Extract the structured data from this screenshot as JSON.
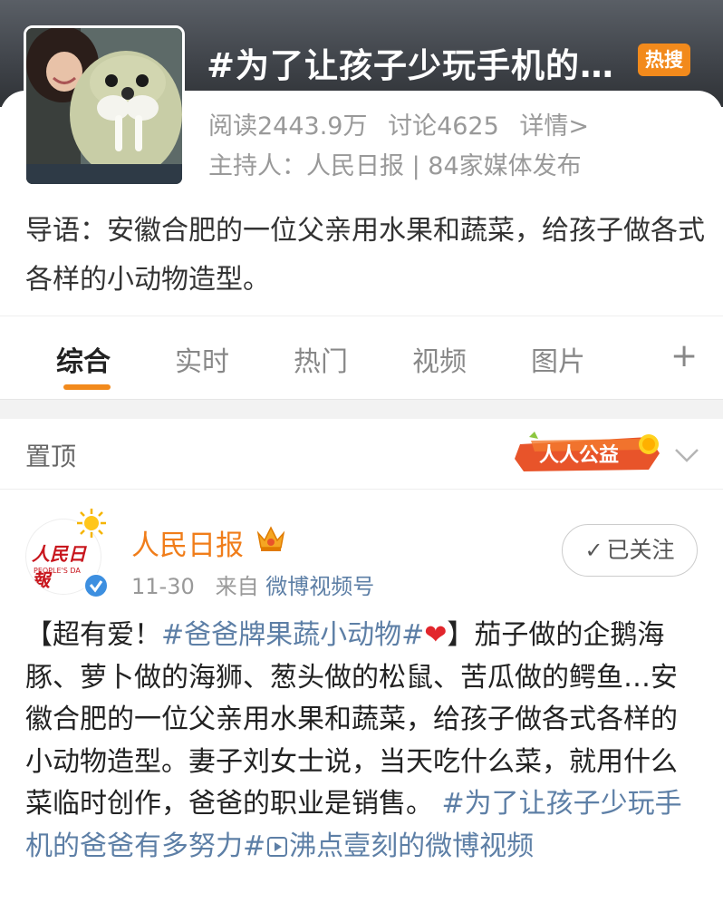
{
  "header": {
    "topic_title": "#为了让孩子少玩手机的…",
    "hot_badge": "热搜",
    "reads": "阅读2443.9万",
    "discussions": "讨论4625",
    "details_link": "详情>",
    "host_line": "主持人：人民日报 | 84家媒体发布",
    "lead": "导语：安徽合肥的一位父亲用水果和蔬菜，给孩子做各式各样的小动物造型。"
  },
  "tabs": [
    {
      "label": "综合",
      "active": true
    },
    {
      "label": "实时",
      "active": false
    },
    {
      "label": "热门",
      "active": false
    },
    {
      "label": "视频",
      "active": false
    },
    {
      "label": "图片",
      "active": false
    }
  ],
  "tabs_add": "+",
  "pinned": {
    "label": "置顶",
    "charity_badge": "人人公益"
  },
  "post": {
    "author": "人民日报",
    "avatar_text": "人民日報",
    "avatar_sub": "PEOPLE'S DA",
    "date": "11-30",
    "from_label": "来自",
    "source": "微博视频号",
    "follow_label": "已关注",
    "body_prefix": "【超有爱！",
    "topic1": "#爸爸牌果蔬小动物#",
    "heart": "❤",
    "body_main": "】茄子做的企鹅海豚、萝卜做的海狮、葱头做的松鼠、苦瓜做的鳄鱼…安徽合肥的一位父亲用水果和蔬菜，给孩子做各式各样的小动物造型。妻子刘女士说，当天吃什么菜，就用什么菜临时创作，爸爸的职业是销售。",
    "topic2": "#为了让孩子少玩手机的爸爸有多努力#",
    "video_link": "沸点壹刻的微博视频"
  },
  "colors": {
    "accent": "#f28a1c",
    "link": "#5d7fa6",
    "author": "#f07d1a"
  }
}
